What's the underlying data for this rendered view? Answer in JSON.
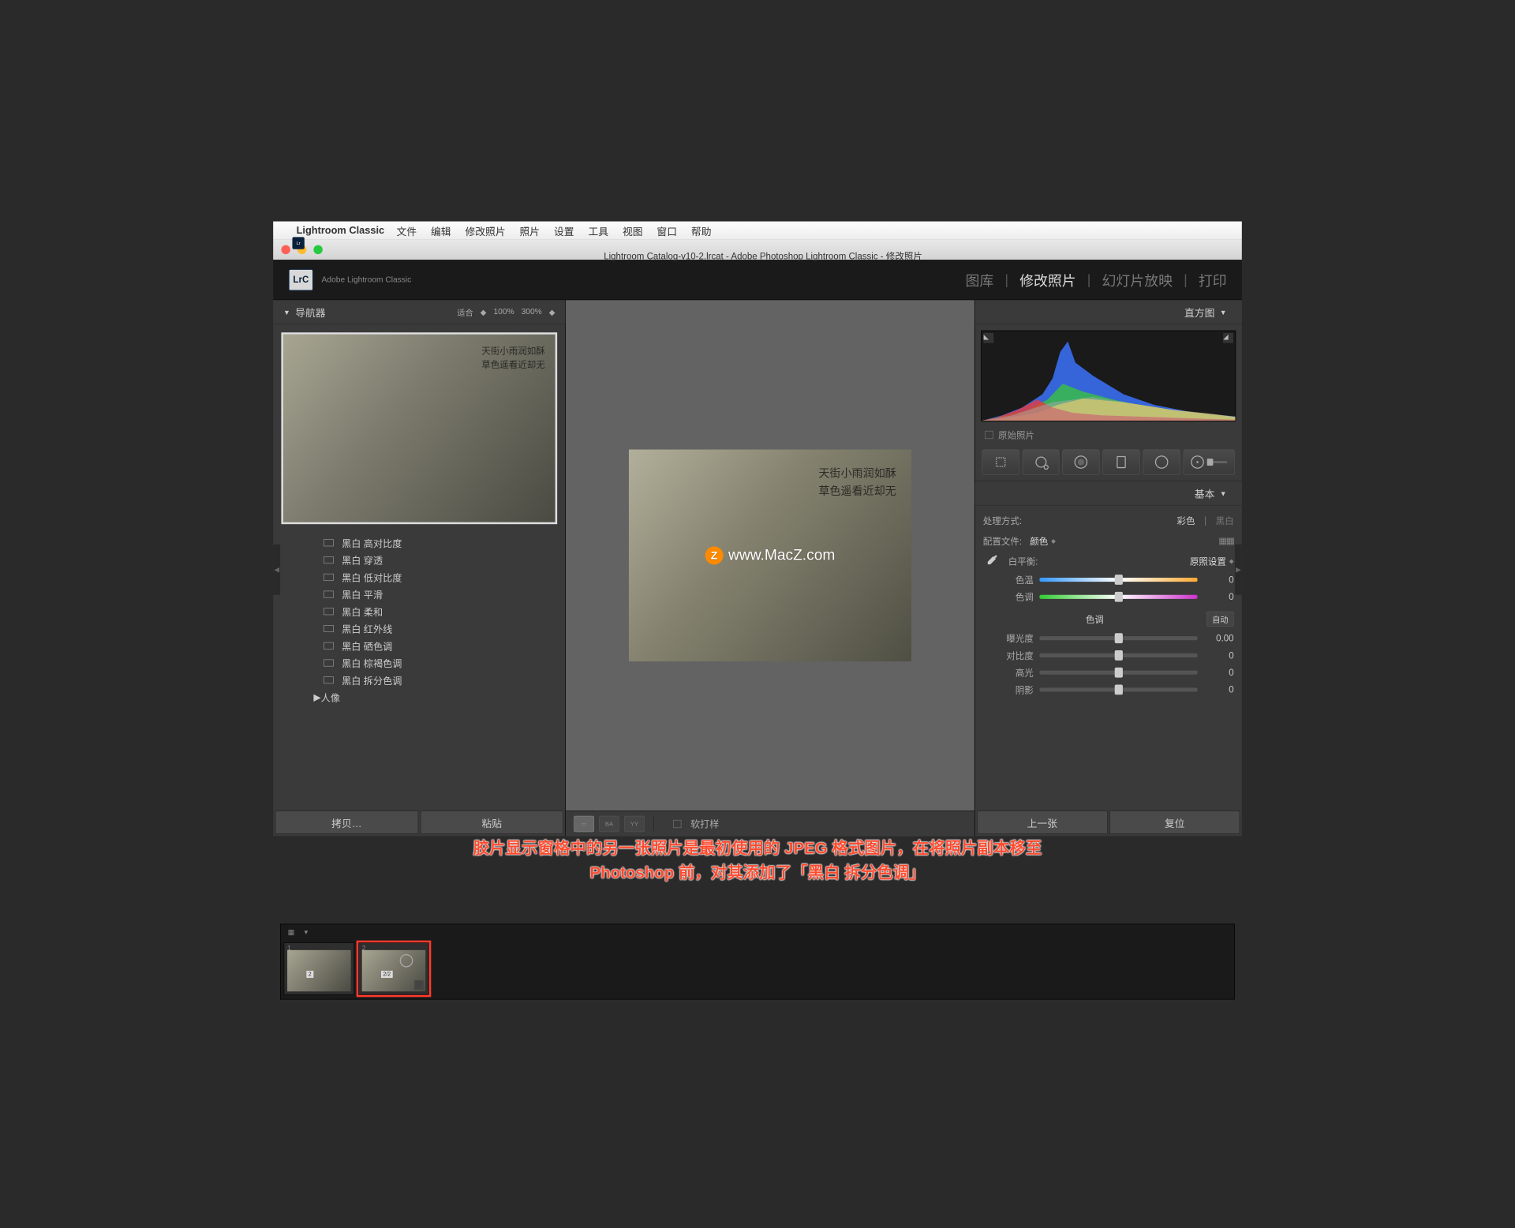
{
  "menubar": {
    "app": "Lightroom Classic",
    "items": [
      "文件",
      "编辑",
      "修改照片",
      "照片",
      "设置",
      "工具",
      "视图",
      "窗口",
      "帮助"
    ]
  },
  "window": {
    "title": "Lightroom Catalog-v10-2.lrcat - Adobe Photoshop Lightroom Classic - 修改照片"
  },
  "brand": {
    "logo": "LrC",
    "name": "Adobe Lightroom Classic",
    "modules": [
      "图库",
      "修改照片",
      "幻灯片放映",
      "打印"
    ],
    "active": "修改照片"
  },
  "navigator": {
    "title": "导航器",
    "zoom": [
      "适合",
      "100%",
      "300%"
    ],
    "calligraphy_l1": "天街小雨润如酥",
    "calligraphy_l2": "草色遥看近却无"
  },
  "presets": {
    "items": [
      "黑白 高对比度",
      "黑白 穿透",
      "黑白 低对比度",
      "黑白 平滑",
      "黑白 柔和",
      "黑白 红外线",
      "黑白 硒色调",
      "黑白 棕褐色调",
      "黑白 拆分色调"
    ],
    "group": "人像"
  },
  "left_buttons": {
    "copy": "拷贝…",
    "paste": "粘贴"
  },
  "center": {
    "calligraphy_l1": "天街小雨润如酥",
    "calligraphy_l2": "草色遥看近却无",
    "watermark": "www.MacZ.com",
    "view_modes": [
      "BA",
      "YY"
    ],
    "soft_proof": "软打样"
  },
  "histogram": {
    "title": "直方图",
    "orig_check": "原始照片"
  },
  "tools": [
    "crop",
    "spot",
    "eye",
    "mask",
    "radial",
    "brush"
  ],
  "basic": {
    "title": "基本",
    "treatment_label": "处理方式:",
    "treatment_color": "彩色",
    "treatment_bw": "黑白",
    "profile_label": "配置文件:",
    "profile_value": "颜色",
    "wb_label": "白平衡:",
    "wb_value": "原照设置",
    "temp_label": "色温",
    "temp_value": "0",
    "tint_label": "色调",
    "tint_value": "0",
    "tone_head": "色调",
    "auto": "自动",
    "exposure_label": "曝光度",
    "exposure_value": "0.00",
    "contrast_label": "对比度",
    "contrast_value": "0",
    "highlights_label": "高光",
    "highlights_value": "0",
    "shadows_label": "阴影",
    "shadows_value": "0"
  },
  "right_buttons": {
    "prev": "上一张",
    "reset": "复位"
  },
  "annotation": {
    "l1": "胶片显示窗格中的另一张照片是最初使用的 JPEG 格式图片，在将照片副本移至",
    "l2": "Photoshop 前，对其添加了「黑白 拆分色调」"
  },
  "filmstrip": {
    "thumb1_badge": "2",
    "thumb2_badge": "2/2"
  }
}
